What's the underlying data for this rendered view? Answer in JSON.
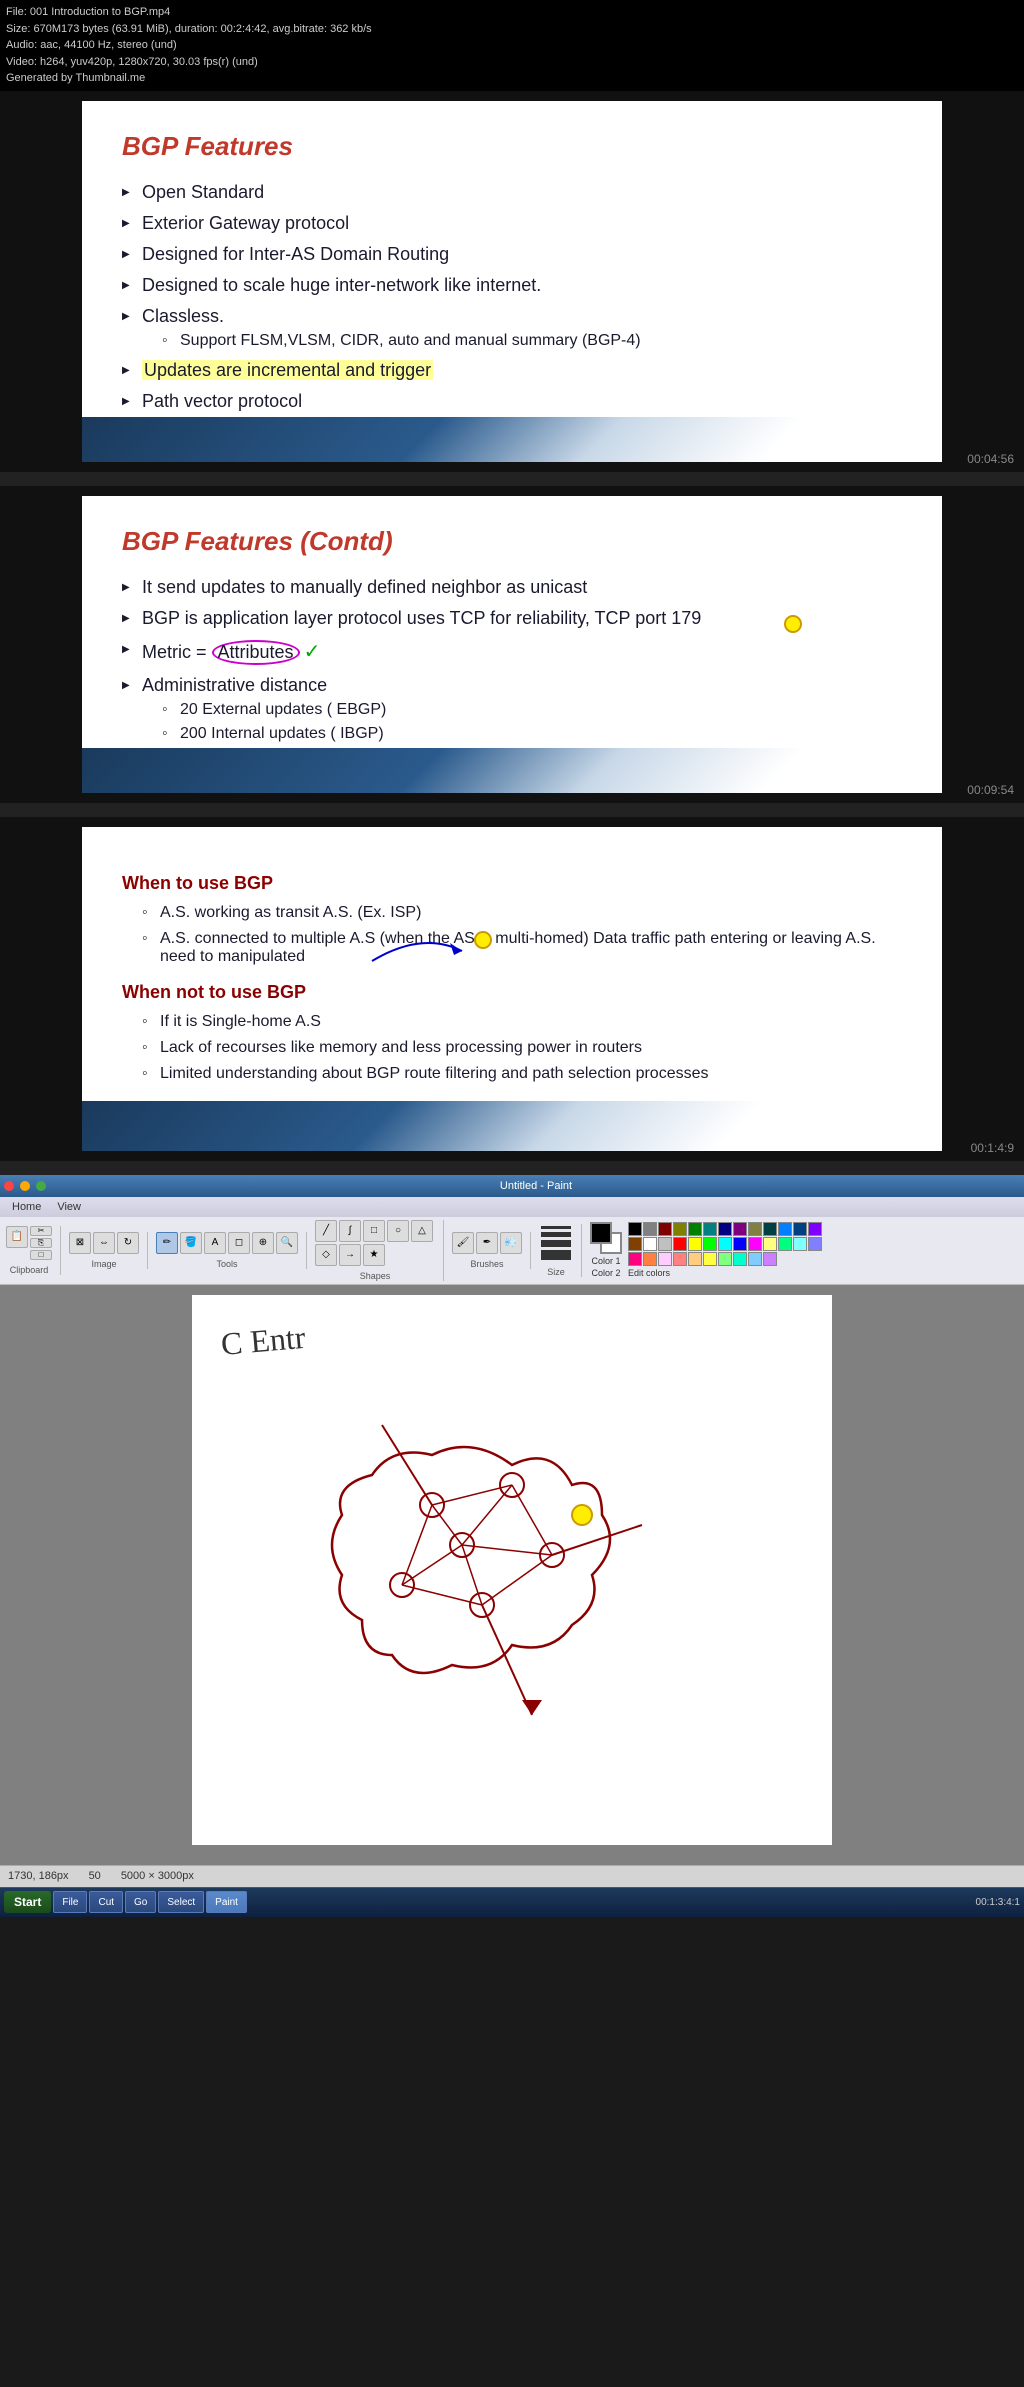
{
  "file_info": {
    "line1": "File: 001 Introduction to BGP.mp4",
    "line2": "Size: 670M173 bytes (63.91 MiB), duration: 00:2:4:42, avg.bitrate: 362 kb/s",
    "line3": "Audio: aac, 44100 Hz, stereo (und)",
    "line4": "Video: h264, yuv420p, 1280x720, 30.03 fps(r) (und)",
    "line5": "Generated by Thumbnail.me"
  },
  "slide1": {
    "title": "BGP Features",
    "bullets": [
      "Open Standard",
      "Exterior Gateway protocol",
      "Designed for Inter-AS Domain Routing",
      "Designed to scale huge inter-network like internet.",
      "Classless."
    ],
    "sub_bullets": [
      "Support FLSM,VLSM, CIDR, auto and manual  summary (BGP-4)"
    ],
    "more_bullets": [
      "Updates are incremental and trigger",
      "Path vector protocol"
    ],
    "timestamp": "00:04:56"
  },
  "slide2": {
    "title": "BGP Features (Contd)",
    "bullets": [
      "It send updates to manually defined neighbor as unicast",
      "BGP is application layer protocol uses TCP for reliability, TCP port 179",
      "Metric = Attributes",
      "Administrative distance"
    ],
    "sub_bullets": [
      "20 External updates ( EBGP)",
      "200 Internal updates  ( IBGP)"
    ],
    "timestamp": "00:09:54"
  },
  "slide3": {
    "when_to_use_heading": "When to use BGP",
    "when_to_use_bullets": [
      "A.S. working as transit A.S. (Ex. ISP)",
      "A.S. connected to multiple A.S (when the AS is multi-homed) Data traffic path entering or leaving A.S. need to  manipulated"
    ],
    "when_not_heading": "When not to use BGP",
    "when_not_bullets": [
      "If it is Single-home A.S",
      "Lack of recourses like memory and less processing  power in routers",
      "Limited understanding  about BGP route filtering and  path selection processes"
    ],
    "timestamp": "00:1:4:9"
  },
  "paint": {
    "title": "Untitled - Paint",
    "menu_items": [
      "Home",
      "View"
    ],
    "tool_groups": [
      "Clipboard",
      "Image",
      "Tools",
      "Shapes",
      "Colors"
    ],
    "clipboard_buttons": [
      "Cut",
      "Copy",
      "Paste",
      "Select"
    ],
    "image_buttons": [
      "Crop",
      "Resize",
      "Rotate"
    ],
    "tools_buttons": [
      "Pencil",
      "Fill",
      "Text",
      "Eraser",
      "Pick"
    ],
    "color1_label": "Color 1",
    "color2_label": "Color 2",
    "edit_colors_label": "Edit colors",
    "colors": [
      "#000000",
      "#808080",
      "#800000",
      "#808000",
      "#008000",
      "#008080",
      "#000080",
      "#800080",
      "#808040",
      "#004040",
      "#0080ff",
      "#004080",
      "#8000ff",
      "#804000",
      "#ffffff",
      "#c0c0c0",
      "#ff0000",
      "#ffff00",
      "#00ff00",
      "#00ffff",
      "#0000ff",
      "#ff00ff",
      "#ffff80",
      "#00ff80",
      "#80ffff",
      "#8080ff",
      "#ff0080",
      "#ff8040",
      "#ffccff",
      "#ff8080",
      "#ffcc80",
      "#ffff40",
      "#80ff80",
      "#00ffcc",
      "#80ccff",
      "#cc80ff"
    ],
    "status_left": "1730, 186px",
    "status_mid1": "50",
    "status_mid2": "5000 × 3000px",
    "canvas_text": "C Entr"
  },
  "windows_taskbar": {
    "start_label": "Start",
    "apps": [
      "File",
      "Cut",
      "Go",
      "Select",
      "Paint"
    ],
    "active_app": "Paint",
    "time": "00:1:3:4:1"
  }
}
